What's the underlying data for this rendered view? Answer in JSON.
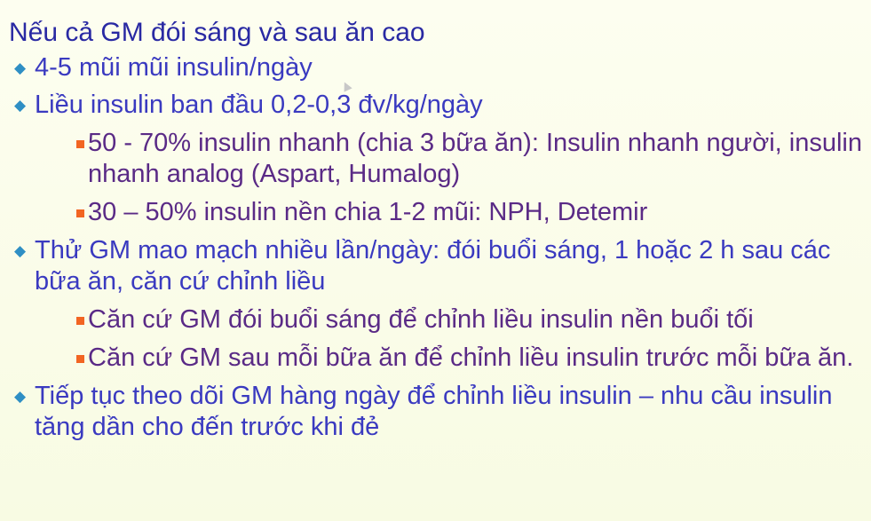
{
  "slide": {
    "title": "Nếu cả GM đói sáng và sau ăn cao",
    "items": [
      {
        "text": "4-5 mũi mũi insulin/ngày",
        "subitems": []
      },
      {
        "text": "Liều insulin ban đầu 0,2-0,3 đv/kg/ngày",
        "subitems": [
          "50 - 70% insulin nhanh (chia 3 bữa ăn): Insulin nhanh người, insulin nhanh analog (Aspart, Humalog)",
          "30 – 50% insulin nền chia 1-2 mũi: NPH, Detemir"
        ]
      },
      {
        "text": "Thử GM mao mạch nhiều lần/ngày: đói buổi sáng, 1 hoặc 2 h sau các bữa ăn, căn cứ chỉnh liều",
        "subitems": [
          "Căn cứ GM đói buổi sáng để chỉnh liều insulin nền buổi tối",
          "Căn cứ GM sau mỗi bữa ăn để chỉnh liều insulin trước mỗi bữa ăn."
        ]
      },
      {
        "text": "Tiếp tục theo dõi GM hàng ngày để chỉnh liều insulin – nhu cầu insulin tăng dần cho đến trước khi đẻ",
        "subitems": []
      }
    ]
  },
  "colors": {
    "title": "#2929a3",
    "level1_text": "#3a3ac0",
    "level1_bullet": "#2f8fc4",
    "level2_text": "#5a2a86",
    "level2_bullet": "#f26522",
    "background": "#fbfde8"
  },
  "icons": {
    "level1_bullet": "diamond-bullet-icon",
    "level2_bullet": "square-bullet-icon",
    "cursor": "mouse-pointer-icon"
  }
}
